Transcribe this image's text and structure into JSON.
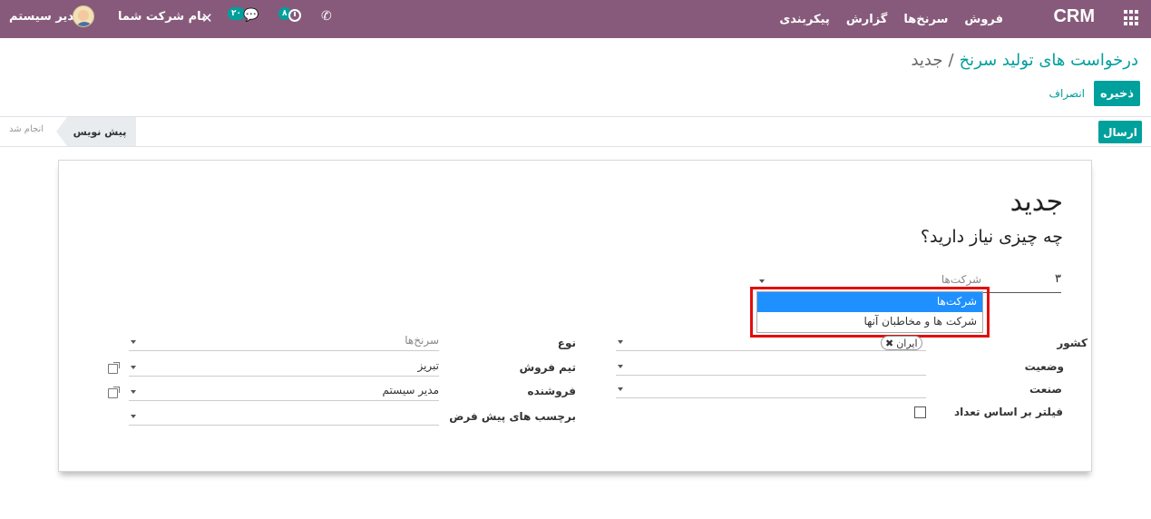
{
  "navbar": {
    "brand": "CRM",
    "menu": [
      "فروش",
      "سرنخ‌ها",
      "گزارش",
      "پیکربندی"
    ],
    "user_name": "مدیر سیستم",
    "company_name": "نام شرکت شما",
    "chat_badge": "۲۰",
    "activity_badge": "۸",
    "colors": {
      "bar": "#875a7b",
      "badge": "#00a09d"
    }
  },
  "breadcrumb": {
    "parent": "درخواست های تولید سرنخ",
    "separator": "/",
    "current": "جدید"
  },
  "actions": {
    "save": "ذخیره",
    "discard": "انصراف"
  },
  "statusbar": {
    "send": "ارسال",
    "stage_draft": "پیش نویس",
    "stage_done": "انجام شد"
  },
  "form": {
    "title": "جدید",
    "subtitle": "چه چیزی نیاز دارید؟",
    "quantity": "۳",
    "search_type": "شرکت‌ها",
    "dropdown_options": [
      "شرکت‌ها",
      "شرکت ها و مخاطبان آنها"
    ],
    "left_labels": {
      "country": "کشور",
      "state": "وضعیت",
      "industry": "صنعت",
      "filter_count": "فیلتر بر اساس تعداد"
    },
    "country_tag": "ایران",
    "right_labels": {
      "type": "نوع",
      "sales_team": "تیم فروش",
      "salesperson": "فروشنده",
      "default_tags": "برچسب های پیش فرض"
    },
    "type_value": "سرنخ‌ها",
    "sales_team_value": "تبریز",
    "salesperson_value": "مدیر سیستم"
  }
}
